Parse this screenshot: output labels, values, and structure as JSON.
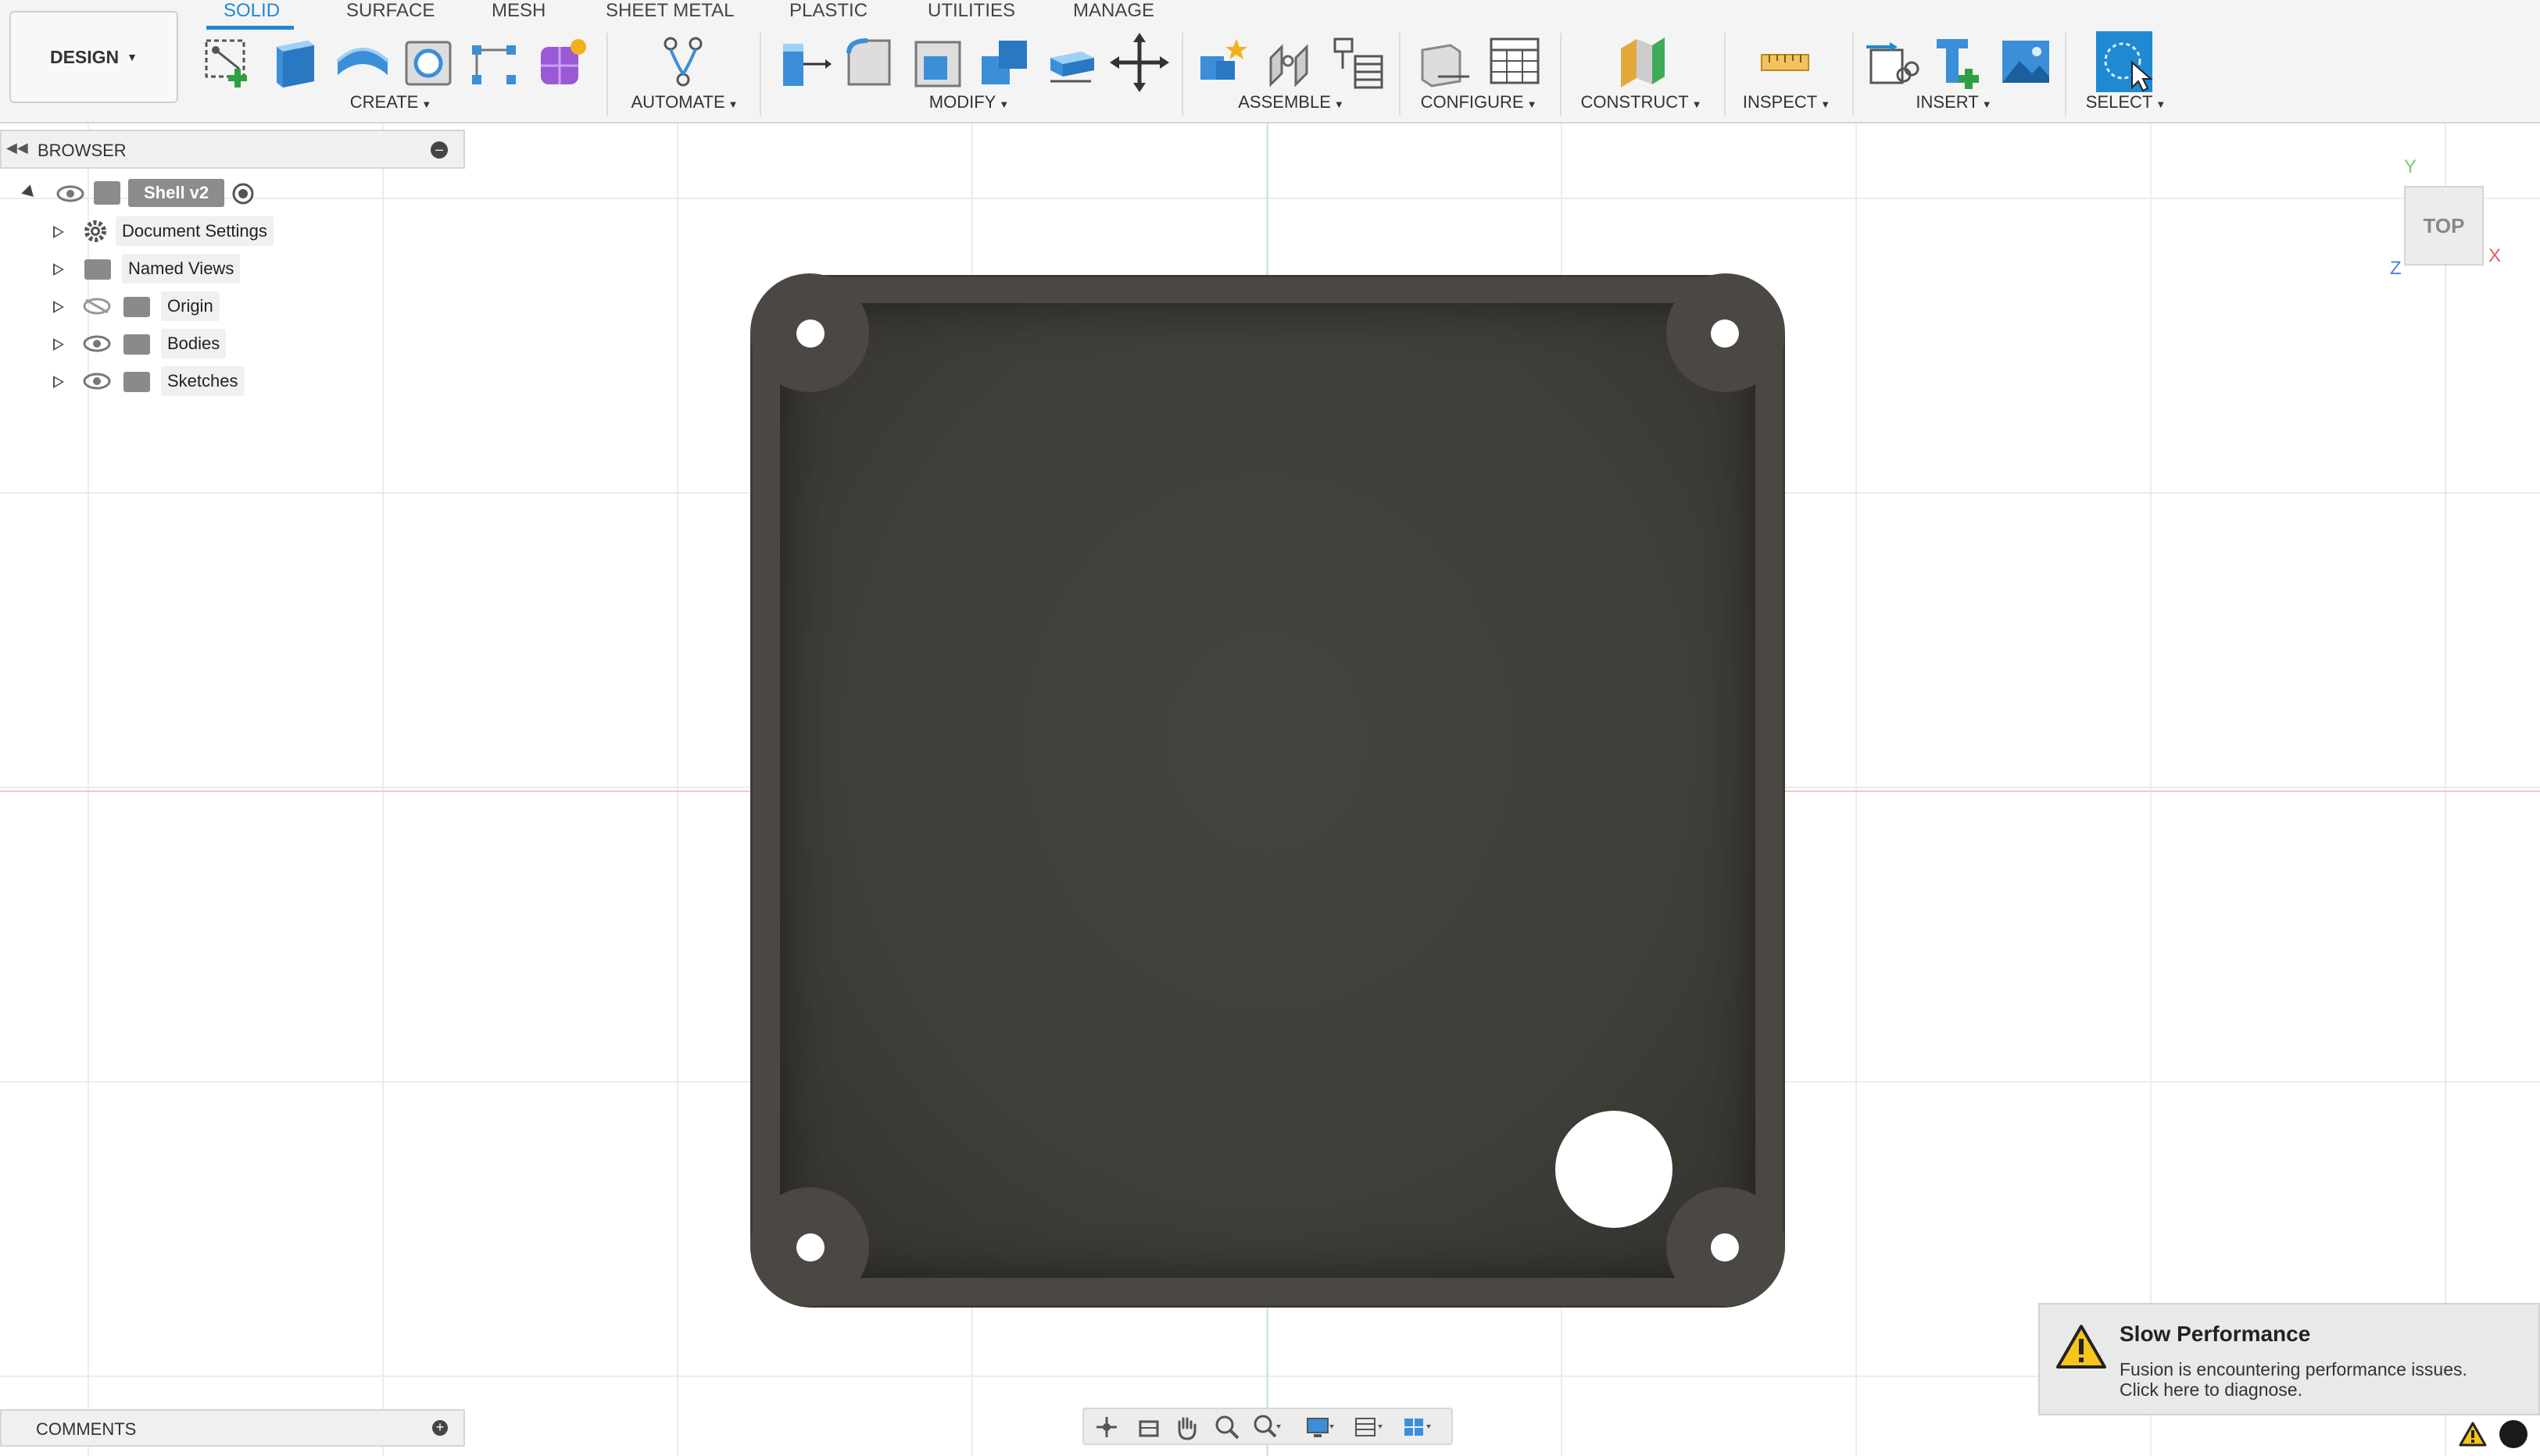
{
  "toolbar": {
    "workspace": "DESIGN",
    "tabs": [
      {
        "label": "SOLID",
        "active": true
      },
      {
        "label": "SURFACE"
      },
      {
        "label": "MESH"
      },
      {
        "label": "SHEET METAL"
      },
      {
        "label": "PLASTIC"
      },
      {
        "label": "UTILITIES"
      },
      {
        "label": "MANAGE"
      }
    ],
    "groups": {
      "create": "CREATE",
      "automate": "AUTOMATE",
      "modify": "MODIFY",
      "assemble": "ASSEMBLE",
      "configure": "CONFIGURE",
      "construct": "CONSTRUCT",
      "inspect": "INSPECT",
      "insert": "INSERT",
      "select": "SELECT"
    },
    "accent_color": "#1f8ad2"
  },
  "browser": {
    "title": "BROWSER",
    "root": "Shell v2",
    "items": [
      {
        "label": "Document Settings",
        "icon": "gear-icon"
      },
      {
        "label": "Named Views",
        "icon": "folder-icon"
      },
      {
        "label": "Origin",
        "icon": "folder-icon",
        "visibility": "hidden-eye-icon"
      },
      {
        "label": "Bodies",
        "icon": "folder-icon",
        "visibility": "eye-icon"
      },
      {
        "label": "Sketches",
        "icon": "folder-icon",
        "visibility": "eye-icon"
      }
    ]
  },
  "viewcube": {
    "face": "TOP",
    "x_label": "X",
    "y_label": "Y",
    "z_label": "Z"
  },
  "comments": {
    "title": "COMMENTS"
  },
  "notification": {
    "title": "Slow Performance",
    "line1": "Fusion is encountering performance issues.",
    "line2": "Click here to diagnose."
  }
}
